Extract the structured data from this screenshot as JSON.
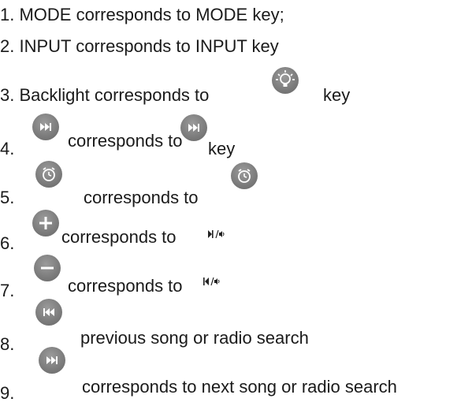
{
  "items": [
    {
      "num": "1.",
      "text": "MODE corresponds to MODE key;"
    },
    {
      "num": "2.",
      "text": "INPUT corresponds to INPUT key"
    },
    {
      "num": "3.",
      "text_a": "Backlight corresponds to",
      "text_b": "key"
    },
    {
      "num": "4.",
      "text_a": "corresponds to",
      "text_b": "key"
    },
    {
      "num": "5.",
      "text_a": "corresponds to"
    },
    {
      "num": "6.",
      "text_a": "corresponds to"
    },
    {
      "num": "7.",
      "text_a": "corresponds to"
    },
    {
      "num": "8.",
      "text_a": "previous song or radio search"
    },
    {
      "num": "9.",
      "text_a": "corresponds to next song or radio search"
    }
  ],
  "colors": {
    "button": "#8a8a8a",
    "text": "#1a1a1a"
  },
  "icons": [
    "lightbulb-icon",
    "next-track-icon",
    "alarm-clock-icon",
    "plus-icon",
    "minus-icon",
    "play-pause-volume-icon",
    "previous-volume-icon",
    "previous-track-icon"
  ]
}
